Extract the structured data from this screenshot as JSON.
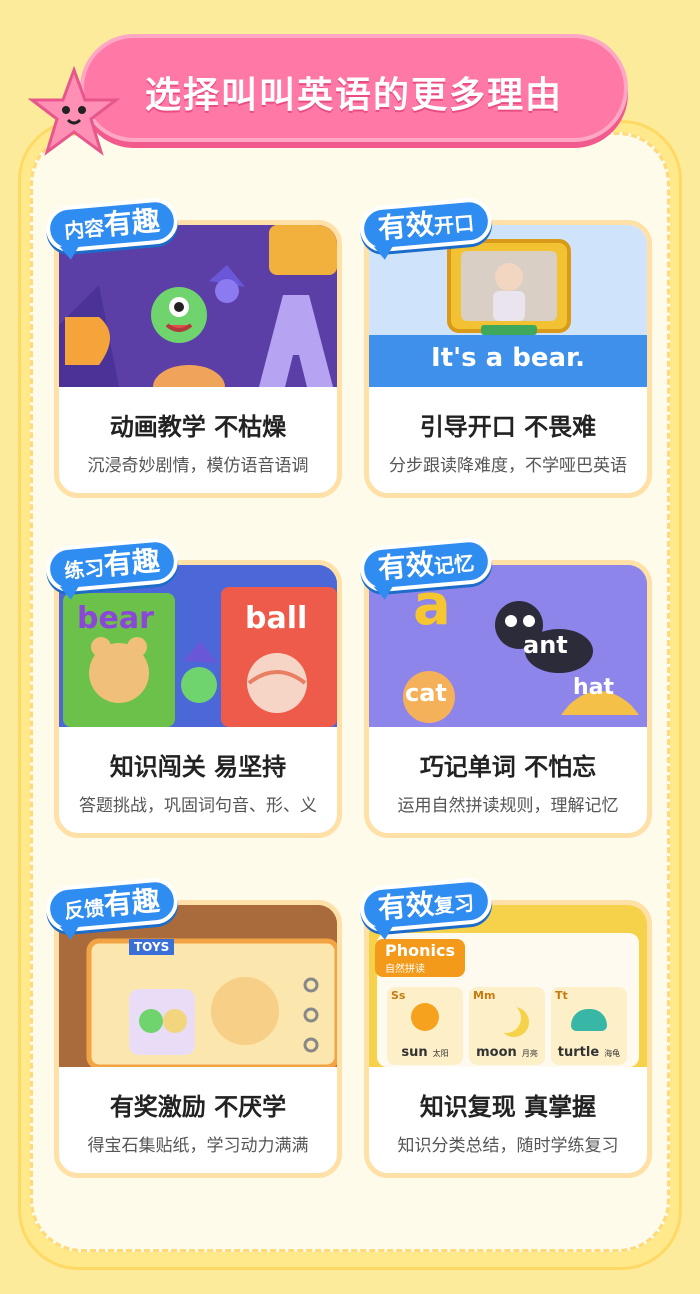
{
  "banner": {
    "title": "选择叫叫英语的更多理由"
  },
  "cards": [
    {
      "tag_a": "内容",
      "tag_b": "有趣",
      "title": "动画教学  不枯燥",
      "subtitle": "沉浸奇妙剧情，模仿语音语调"
    },
    {
      "tag_a": "有效",
      "tag_b": "开口",
      "title": "引导开口  不畏难",
      "subtitle": "分步跟读降难度，不学哑巴英语",
      "illustration_text": "It's a bear."
    },
    {
      "tag_a": "练习",
      "tag_b": "有趣",
      "title": "知识闯关  易坚持",
      "subtitle": "答题挑战，巩固词句音、形、义",
      "word_left": "bear",
      "word_right": "ball"
    },
    {
      "tag_a": "有效",
      "tag_b": "记忆",
      "title": "巧记单词  不怕忘",
      "subtitle": "运用自然拼读规则，理解记忆",
      "letter": "a",
      "word_1": "ant",
      "word_2": "cat",
      "word_3": "hat"
    },
    {
      "tag_a": "反馈",
      "tag_b": "有趣",
      "title": "有奖激励  不厌学",
      "subtitle": "得宝石集贴纸，学习动力满满",
      "sticker_label": "TOYS"
    },
    {
      "tag_a": "有效",
      "tag_b": "复习",
      "title": "知识复现  真掌握",
      "subtitle": "知识分类总结，随时学练复习",
      "phonics_title": "Phonics",
      "phonics_sub": "自然拼读",
      "phonics_items": [
        {
          "letter": "Ss",
          "word": "sun",
          "cn": "太阳"
        },
        {
          "letter": "Mm",
          "word": "moon",
          "cn": "月亮"
        },
        {
          "letter": "Tt",
          "word": "turtle",
          "cn": "海龟"
        }
      ]
    }
  ],
  "colors": {
    "banner": "#ff78a6",
    "tag": "#2f8df2",
    "background": "#fdeb9c"
  }
}
